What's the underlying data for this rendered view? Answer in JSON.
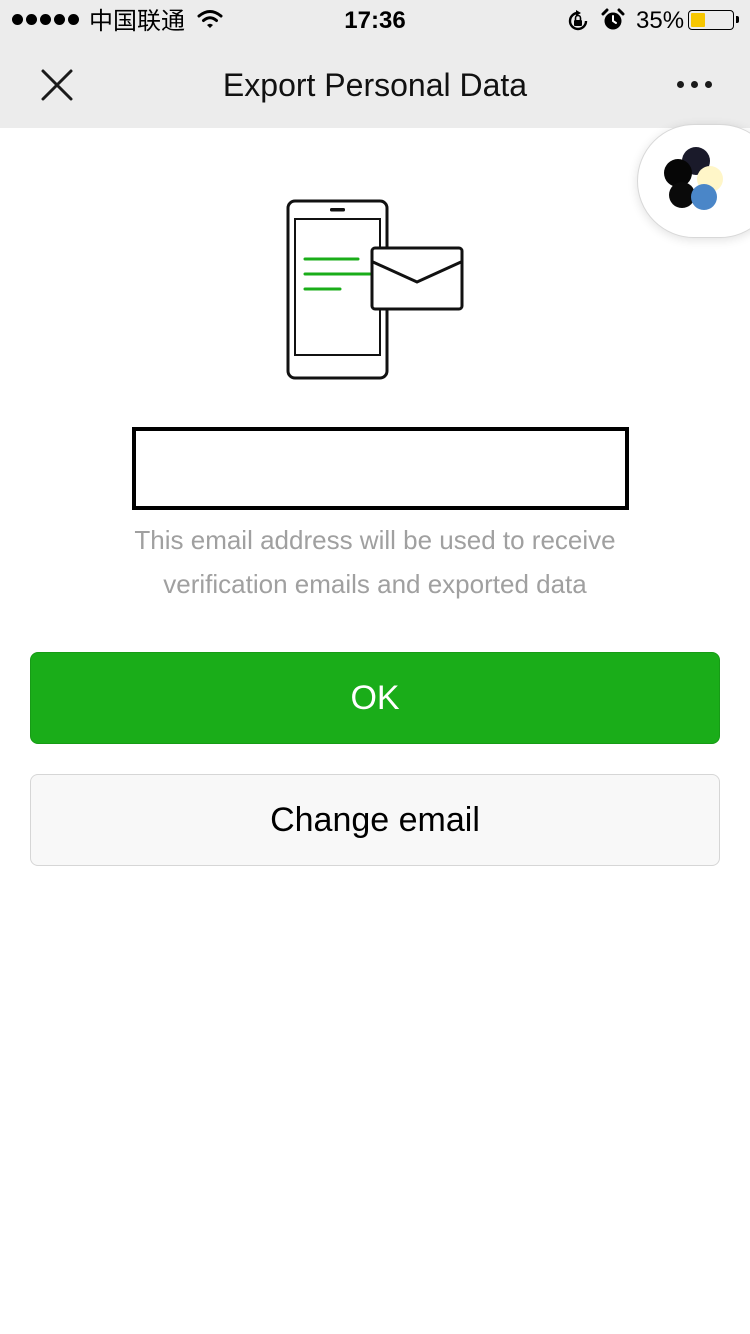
{
  "status_bar": {
    "carrier": "中国联通",
    "time": "17:36",
    "battery_percent": "35%",
    "battery_level": 0.35,
    "icons": [
      "signal-dots-icon",
      "wifi-icon",
      "rotation-lock-icon",
      "alarm-icon",
      "battery-icon"
    ]
  },
  "navbar": {
    "title": "Export Personal Data",
    "close_icon": "close-icon",
    "more_icon": "more-dots-icon"
  },
  "floating_widget": {
    "icon": "mini-program-capsule-icon"
  },
  "main": {
    "illustration_icon": "phone-with-envelope-icon",
    "email_value": "",
    "hint_line1": "This email address will be used to receive",
    "hint_line2": "verification emails and exported data",
    "ok_label": "OK",
    "change_email_label": "Change email"
  },
  "colors": {
    "primary_green": "#1aad19",
    "nav_background": "#ececec",
    "hint_text": "#a0a0a0",
    "battery_fill": "#f6c600"
  }
}
